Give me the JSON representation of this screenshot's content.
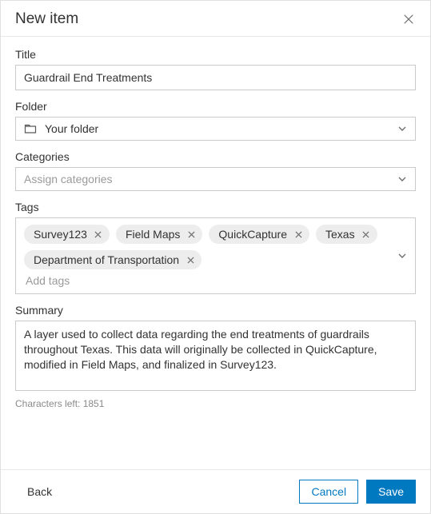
{
  "header": {
    "title": "New item"
  },
  "fields": {
    "title_label": "Title",
    "title_value": "Guardrail End Treatments",
    "folder_label": "Folder",
    "folder_value": "Your folder",
    "categories_label": "Categories",
    "categories_placeholder": "Assign categories",
    "tags_label": "Tags",
    "tags": [
      {
        "label": "Survey123"
      },
      {
        "label": "Field Maps"
      },
      {
        "label": "QuickCapture"
      },
      {
        "label": "Texas"
      },
      {
        "label": "Department of Transportation"
      }
    ],
    "add_tags_placeholder": "Add tags",
    "summary_label": "Summary",
    "summary_value": "A layer used to collect data regarding the end treatments of guardrails throughout Texas. This data will originally be collected in QuickCapture, modified in Field Maps, and finalized in Survey123.",
    "chars_left_label": "Characters left: 1851"
  },
  "footer": {
    "back_label": "Back",
    "cancel_label": "Cancel",
    "save_label": "Save"
  }
}
